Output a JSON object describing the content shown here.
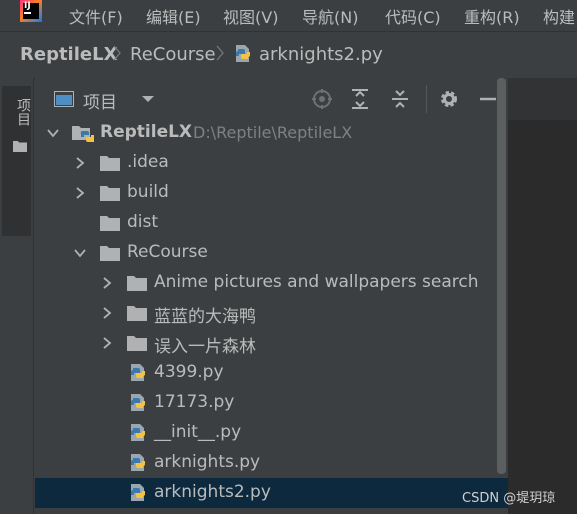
{
  "menu": {
    "items": [
      "文件(F)",
      "编辑(E)",
      "视图(V)",
      "导航(N)",
      "代码(C)",
      "重构(R)",
      "构建"
    ]
  },
  "breadcrumb": {
    "items": [
      "ReptileLX",
      "ReCourse",
      "arknights2.py"
    ]
  },
  "toolstrip": {
    "label": "项目"
  },
  "panel": {
    "title": "项目"
  },
  "tree": {
    "root": {
      "name": "ReptileLX",
      "path": "D:\\Reptile\\ReptileLX"
    },
    "items": [
      {
        "name": ".idea",
        "type": "folder",
        "expanded": false
      },
      {
        "name": "build",
        "type": "folder",
        "expanded": false
      },
      {
        "name": "dist",
        "type": "folder",
        "expanded": false
      },
      {
        "name": "ReCourse",
        "type": "folder",
        "expanded": true
      },
      {
        "name": "Anime pictures and wallpapers search",
        "type": "folder",
        "expanded": false
      },
      {
        "name": "蓝蓝的大海鸭",
        "type": "folder",
        "expanded": false
      },
      {
        "name": "误入一片森林",
        "type": "folder",
        "expanded": false
      },
      {
        "name": "4399.py",
        "type": "python-file"
      },
      {
        "name": "17173.py",
        "type": "python-file"
      },
      {
        "name": "__init__.py",
        "type": "python-file"
      },
      {
        "name": "arknights.py",
        "type": "python-file"
      },
      {
        "name": "arknights2.py",
        "type": "python-file",
        "selected": true
      }
    ]
  },
  "watermark": "CSDN @堤玥琼",
  "colors": {
    "background": "#3c3f41",
    "editor": "#2b2b2b",
    "selection": "#0d293e",
    "text": "#bbbbbb",
    "path_text": "#808080",
    "folder": "#afb1b3",
    "python_blue": "#3c78aa",
    "python_yellow": "#f5c242"
  }
}
